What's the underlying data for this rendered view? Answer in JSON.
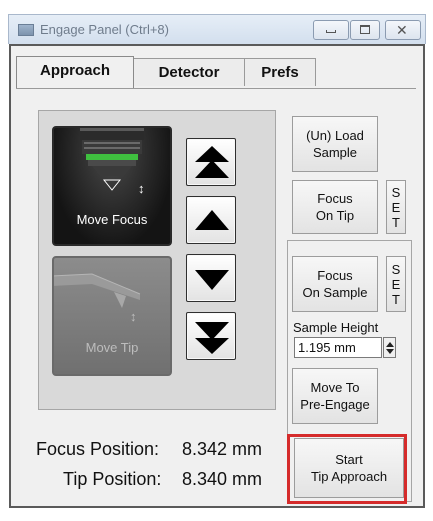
{
  "window": {
    "title": "Engage Panel (Ctrl+8)",
    "icon": "panel-icon",
    "controls": [
      "minimize-icon",
      "maximize-icon",
      "close-icon"
    ]
  },
  "tabs": [
    {
      "label": "Approach",
      "active": true
    },
    {
      "label": "Detector",
      "active": false
    },
    {
      "label": "Prefs",
      "active": false
    }
  ],
  "motion": {
    "focus_card": {
      "label": "Move Focus",
      "icon": "objective-lens-icon",
      "indicator_icon": "up-down-arrows-icon",
      "active": true
    },
    "tip_card": {
      "label": "Move Tip",
      "icon": "cantilever-tip-icon",
      "indicator_icon": "up-down-arrows-icon",
      "active": false
    },
    "arrow_buttons": [
      {
        "name": "fast-up",
        "icon": "double-triangle-up-icon"
      },
      {
        "name": "up",
        "icon": "triangle-up-icon"
      },
      {
        "name": "down",
        "icon": "triangle-down-icon"
      },
      {
        "name": "fast-down",
        "icon": "double-triangle-down-icon"
      }
    ]
  },
  "controls": {
    "load_sample": "(Un) Load\nSample",
    "focus_on_tip": "Focus\nOn Tip",
    "set_tip": "S\nE\nT",
    "focus_on_sample": "Focus\nOn Sample",
    "set_sample": "S\nE\nT",
    "sample_height_label": "Sample Height",
    "sample_height_value": "1.195 mm",
    "move_to_preengage": "Move To\nPre-Engage",
    "start_tip_approach": "Start\nTip Approach"
  },
  "readouts": {
    "focus_label": "Focus Position:",
    "focus_value": "8.342 mm",
    "tip_label": "Tip Position:",
    "tip_value": "8.340 mm"
  },
  "colors": {
    "highlight": "#d52b2b",
    "panel_bg": "#f0f0f0",
    "motion_bg": "#d9d9d9",
    "lens_ring": "#3fbf3f"
  }
}
